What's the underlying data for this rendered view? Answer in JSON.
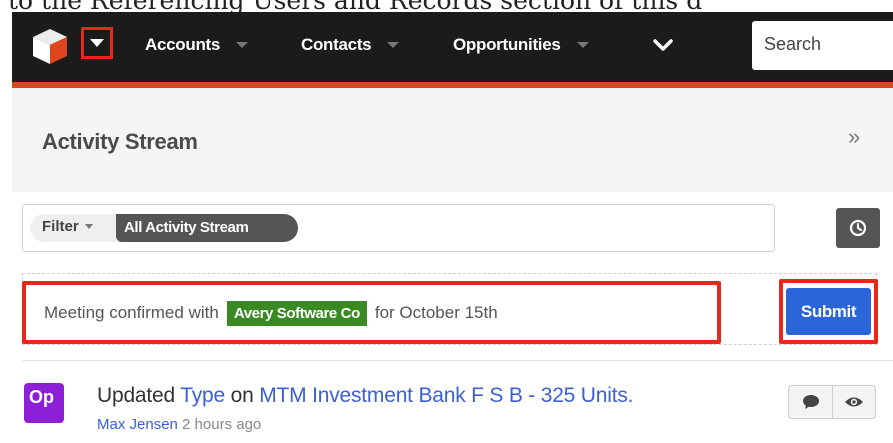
{
  "document": {
    "heading_fragment": "to the Referencing Users and Records section of this d"
  },
  "navbar": {
    "menu_items": [
      {
        "label": "Accounts"
      },
      {
        "label": "Contacts"
      },
      {
        "label": "Opportunities"
      }
    ],
    "search_placeholder": "Search",
    "brand_colors": {
      "bar": "#1b1b1b",
      "stripe": "#e0461d"
    }
  },
  "header": {
    "title": "Activity Stream",
    "toggle_glyph": "»"
  },
  "filter": {
    "label": "Filter",
    "active_filter": "All Activity Stream"
  },
  "composer": {
    "text_before": "Meeting confirmed with",
    "mention": "Avery Software Co",
    "text_after": "for October 15th",
    "submit_label": "Submit",
    "mention_color": "#3a8a24",
    "highlight_color": "#e8261a"
  },
  "activity": {
    "avatar_text": "Op",
    "avatar_color": "#8d1fd6",
    "action": "Updated",
    "field": "Type",
    "preposition": "on",
    "record": "MTM Investment Bank F S B - 325 Units.",
    "author": "Max Jensen",
    "time": "2 hours ago",
    "icons": [
      "comment-icon",
      "eye-icon"
    ]
  }
}
